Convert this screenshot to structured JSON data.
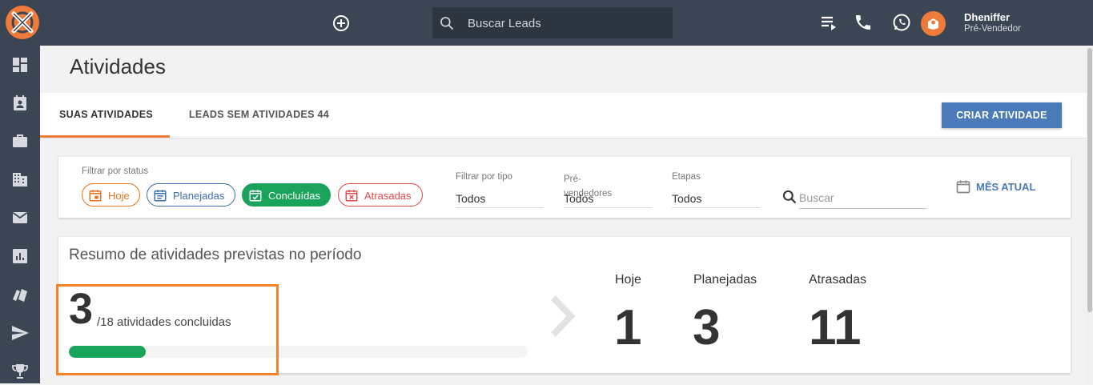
{
  "header": {
    "search_placeholder": "Buscar Leads",
    "user": {
      "name": "Dheniffer",
      "role": "Pré-Vendedor"
    }
  },
  "page": {
    "title": "Atividades"
  },
  "tabs": [
    {
      "label": "SUAS ATIVIDADES",
      "active": true
    },
    {
      "label": "LEADS SEM ATIVIDADES 44",
      "active": false
    }
  ],
  "create_button": "CRIAR ATIVIDADE",
  "filters": {
    "status_label": "Filtrar por status",
    "status_chips": [
      {
        "label": "Hoje",
        "color": "#e8731e"
      },
      {
        "label": "Planejadas",
        "color": "#3f6fae"
      },
      {
        "label": "Concluídas",
        "color": "#1aa35a",
        "selected": true
      },
      {
        "label": "Atrasadas",
        "color": "#e04a4a"
      }
    ],
    "type_label": "Filtrar por tipo",
    "type_value": "Todos",
    "presellers_label": "Pré-vendedores",
    "presellers_value": "Todos",
    "stages_label": "Etapas",
    "stages_value": "Todos",
    "search_placeholder": "Buscar",
    "period_button": "MÊS ATUAL"
  },
  "summary": {
    "title": "Resumo de atividades previstas no período",
    "completed": "3",
    "total_text": "/18 atividades concluidas",
    "progress_fraction": 0.1667,
    "stats": [
      {
        "label": "Hoje",
        "value": "1"
      },
      {
        "label": "Planejadas",
        "value": "3"
      },
      {
        "label": "Atrasadas",
        "value": "11"
      }
    ]
  },
  "colors": {
    "topbar": "#3b4554",
    "accent": "#ef7b3a",
    "primary_button": "#4a7ab8",
    "progress": "#1aa35a",
    "highlight_border": "#f5822a"
  }
}
